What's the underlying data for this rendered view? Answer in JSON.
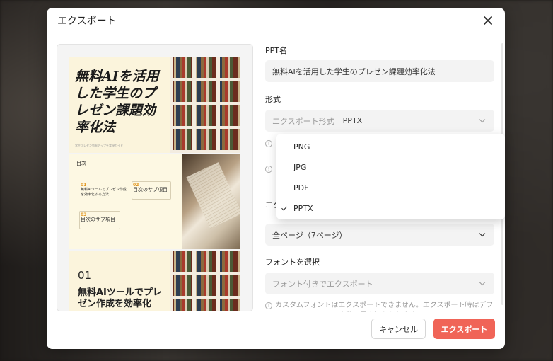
{
  "dialog": {
    "title": "エクスポート",
    "close_icon": "close-icon"
  },
  "preview": {
    "slide1": {
      "title": "無料AIを活用した学生のプレゼン課題効率化法",
      "subtitle": "学生プレゼン効率アップを実現ガイド"
    },
    "slide2": {
      "heading": "目次",
      "items": [
        {
          "num": "01",
          "text": "無料AIツールでプレゼン作成を効率化する方法"
        },
        {
          "num": "02",
          "text": "目次のサブ項目"
        },
        {
          "num": "03",
          "text": "目次のサブ項目"
        }
      ]
    },
    "slide3": {
      "num": "01",
      "title": "無料AIツールでプレゼン作成を効率化"
    }
  },
  "form": {
    "ppt_name_label": "PPT名",
    "ppt_name_value": "無料AIを活用した学生のプレゼン課題効率化法",
    "format_label": "形式",
    "format_prefix": "エクスポート形式",
    "format_value": "PPTX",
    "page_label_partial": "エク",
    "pages_value": "全ページ（7ページ）",
    "font_label": "フォントを選択",
    "font_value": "フォント付きでエクスポート",
    "font_note": "カスタムフォントはエクスポートできません。エクスポート時はデフォルトのフォントに自動で置き換えられます"
  },
  "dropdown": {
    "options": [
      "PNG",
      "JPG",
      "PDF",
      "PPTX"
    ],
    "selected": "PPTX"
  },
  "footer": {
    "cancel_label": "キャンセル",
    "export_label": "エクスポート"
  },
  "colors": {
    "accent": "#f06457",
    "toc_number": "#e0941c"
  }
}
